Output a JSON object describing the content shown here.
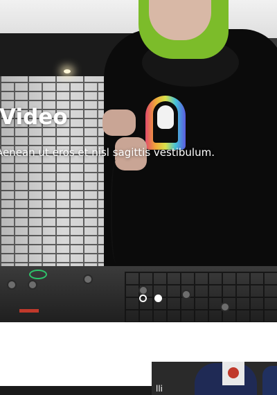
{
  "hero": {
    "title": "Video",
    "subtitle": "Aenean ut eros et nisl sagittis vestibulum.",
    "slides": [
      {
        "state": "inactive"
      },
      {
        "state": "active"
      }
    ]
  },
  "next_section": {
    "thumbnail_caption": "lli"
  },
  "colors": {
    "hero_text": "#ffffff",
    "hair_green": "#7cbc2a",
    "page_background": "#ffffff"
  }
}
